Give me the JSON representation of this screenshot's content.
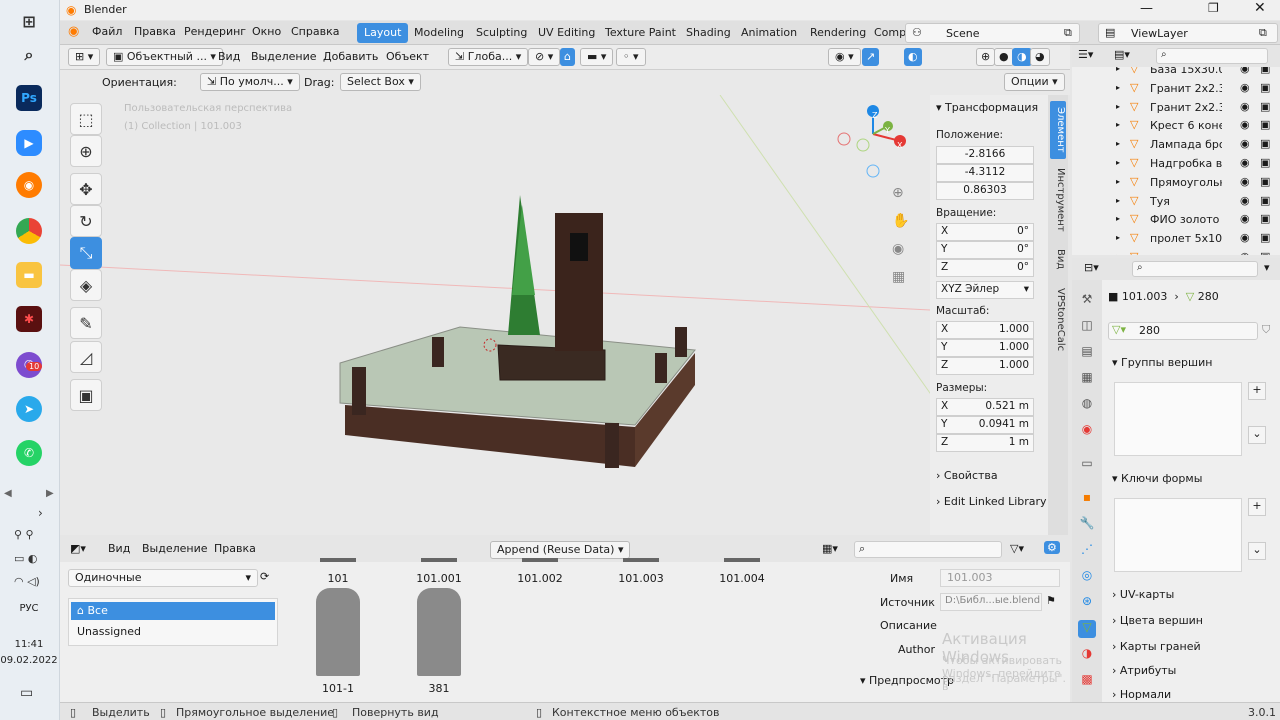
{
  "app": {
    "title": "Blender",
    "version": "3.0.1"
  },
  "taskbar": {
    "icons": [
      "windows-start-icon",
      "search-icon",
      "photoshop-icon",
      "zoom-icon",
      "blender-icon",
      "chrome-icon",
      "file-explorer-icon",
      "app-red-icon",
      "viber-icon",
      "telegram-icon",
      "whatsapp-icon"
    ],
    "ps_label": "Ps",
    "viber_badge": "10",
    "lang": "РУС",
    "time": "11:41",
    "date": "09.02.2022"
  },
  "menu": {
    "items": [
      "Файл",
      "Правка",
      "Рендеринг",
      "Окно",
      "Справка"
    ],
    "workspaces": [
      "Layout",
      "Modeling",
      "Sculpting",
      "UV Editing",
      "Texture Paint",
      "Shading",
      "Animation",
      "Rendering",
      "Comp"
    ],
    "active_workspace": "Layout",
    "scene": "Scene",
    "view_layer": "ViewLayer"
  },
  "viewport_header": {
    "mode": "Объектный ...",
    "menus": [
      "Вид",
      "Выделение",
      "Добавить",
      "Объект"
    ],
    "transform": "Глоба...",
    "orientation_label": "Ориентация:",
    "orientation_value": "По умолч...",
    "drag_label": "Drag:",
    "drag_value": "Select Box",
    "options": "Опции"
  },
  "viewport": {
    "overlay_line1": "Пользовательская перспектива",
    "overlay_line2": "(1) Collection | 101.003",
    "axes": {
      "z": "Z",
      "y": "Y",
      "x": "X"
    }
  },
  "npanel": {
    "section": "Трансформация",
    "location_label": "Положение:",
    "location": [
      "-2.8166",
      "-4.3112",
      "0.86303"
    ],
    "rotation_label": "Вращение:",
    "rotation": [
      {
        "axis": "X",
        "value": "0°"
      },
      {
        "axis": "Y",
        "value": "0°"
      },
      {
        "axis": "Z",
        "value": "0°"
      }
    ],
    "rotation_mode": "XYZ Эйлер",
    "scale_label": "Масштаб:",
    "scale": [
      {
        "axis": "X",
        "value": "1.000"
      },
      {
        "axis": "Y",
        "value": "1.000"
      },
      {
        "axis": "Z",
        "value": "1.000"
      }
    ],
    "dimensions_label": "Размеры:",
    "dimensions": [
      {
        "axis": "X",
        "value": "0.521 m"
      },
      {
        "axis": "Y",
        "value": "0.0941 m"
      },
      {
        "axis": "Z",
        "value": "1 m"
      }
    ],
    "props": "Свойства",
    "linked_lib": "Edit Linked Library",
    "tabs": [
      "Элемент",
      "Инструмент",
      "Вид",
      "VPStoneCalc"
    ]
  },
  "outliner": {
    "items": [
      "База 15x30.0",
      "Гранит 2x2.3",
      "Гранит 2x2.3",
      "Крест 6 коне",
      "Лампада бро",
      "Надгробка во",
      "Прямоугольн",
      "Туя",
      "ФИО золото",
      "пролет 5x10",
      "..."
    ]
  },
  "properties": {
    "object": "101.003",
    "mesh": "280",
    "mesh_field": "280",
    "sections": [
      "Группы вершин",
      "Ключи формы",
      "UV-карты",
      "Цвета вершин",
      "Карты граней",
      "Атрибуты",
      "Нормали"
    ]
  },
  "filebrowser": {
    "menus": [
      "Вид",
      "Выделение",
      "Правка"
    ],
    "import_mode": "Append (Reuse Data)",
    "filter": "Одиночные",
    "catalogs": [
      "Все",
      "Unassigned"
    ],
    "assets": [
      "101",
      "101.001",
      "101.002",
      "101.003",
      "101.004",
      "101-1",
      "381"
    ],
    "meta": {
      "name_label": "Имя",
      "name": "101.003",
      "source_label": "Источник",
      "source": "D:\\Библ...ые.blend",
      "desc_label": "Описание",
      "author_label": "Author",
      "preview": "Предпросмотр"
    },
    "watermark1": "Активация Windows",
    "watermark2": "Чтобы активировать Windows, перейдите в",
    "watermark3": "раздел \"Параметры\"."
  },
  "status": {
    "items": [
      "Выделить",
      "Прямоугольное выделение",
      "Повернуть вид",
      "Контекстное меню объектов"
    ]
  },
  "colors": {
    "accent": "#3d8fe0",
    "axis_x": "#e53935",
    "axis_y": "#7cb342",
    "axis_z": "#1e88e5"
  }
}
